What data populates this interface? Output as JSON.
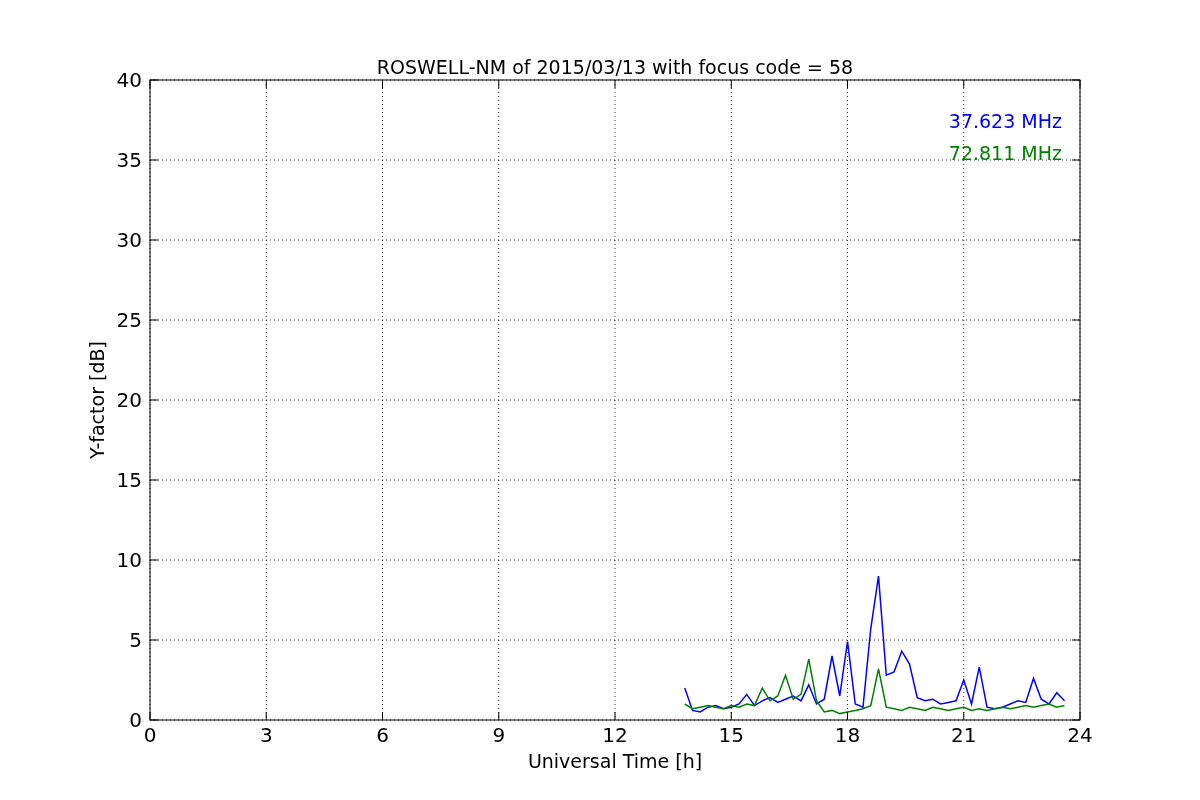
{
  "figure": {
    "chart_data": {
      "type": "line",
      "title": "ROSWELL-NM of 2015/03/13 with focus code = 58",
      "xlabel": "Universal Time [h]",
      "ylabel": "Y-factor [dB]",
      "xlim": [
        0,
        24
      ],
      "ylim": [
        0,
        40
      ],
      "grid": true,
      "xticks": [
        0,
        3,
        6,
        9,
        12,
        15,
        18,
        21,
        24
      ],
      "yticks": [
        0,
        5,
        10,
        15,
        20,
        25,
        30,
        35,
        40
      ],
      "x": [
        13.8,
        14,
        14.2,
        14.4,
        14.6,
        14.8,
        15,
        15.2,
        15.4,
        15.6,
        15.8,
        16,
        16.2,
        16.4,
        16.6,
        16.8,
        17,
        17.2,
        17.4,
        17.6,
        17.8,
        18,
        18.2,
        18.4,
        18.6,
        18.8,
        19,
        19.2,
        19.4,
        19.6,
        19.8,
        20,
        20.2,
        20.4,
        20.6,
        20.8,
        21,
        21.2,
        21.4,
        21.6,
        21.8,
        22,
        22.2,
        22.4,
        22.6,
        22.8,
        23,
        23.2,
        23.4,
        23.6
      ],
      "series": [
        {
          "name": "37.623 MHz",
          "color": "#0000ff",
          "values": [
            2.0,
            0.6,
            0.5,
            0.8,
            0.9,
            0.7,
            0.8,
            1.0,
            1.6,
            0.9,
            1.2,
            1.4,
            1.1,
            1.3,
            1.5,
            1.2,
            2.2,
            1.0,
            1.3,
            4.0,
            1.5,
            4.9,
            1.0,
            0.8,
            5.7,
            9.0,
            2.8,
            3.0,
            4.3,
            3.5,
            1.4,
            1.2,
            1.3,
            1.0,
            1.1,
            1.2,
            2.5,
            1.0,
            3.3,
            0.8,
            0.7,
            0.8,
            1.0,
            1.2,
            1.1,
            2.6,
            1.3,
            1.0,
            1.7,
            1.2
          ]
        },
        {
          "name": "72.811 MHz",
          "color": "#008000",
          "values": [
            1.0,
            0.7,
            0.8,
            0.9,
            0.8,
            0.7,
            0.9,
            0.8,
            1.0,
            0.9,
            2.0,
            1.2,
            1.5,
            2.8,
            1.3,
            1.6,
            3.8,
            1.2,
            0.5,
            0.6,
            0.4,
            0.5,
            0.6,
            0.7,
            0.9,
            3.2,
            0.8,
            0.7,
            0.6,
            0.8,
            0.7,
            0.6,
            0.8,
            0.7,
            0.6,
            0.7,
            0.8,
            0.6,
            0.7,
            0.6,
            0.7,
            0.8,
            0.7,
            0.8,
            0.9,
            0.8,
            0.9,
            1.0,
            0.8,
            0.9
          ]
        }
      ]
    }
  }
}
